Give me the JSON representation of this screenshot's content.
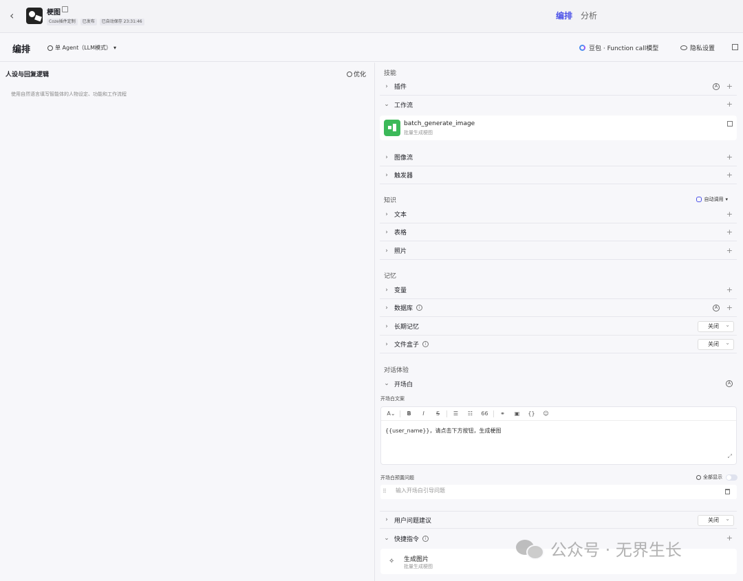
{
  "header": {
    "bot_name": "梗图",
    "tags": [
      "Coze插件定制",
      "已发布",
      "已自动保存 23:31:46"
    ],
    "tabs": [
      {
        "label": "编排",
        "active": true
      },
      {
        "label": "分析",
        "active": false
      }
    ]
  },
  "subheader": {
    "title": "编排",
    "mode": "单 Agent（LLM模式）",
    "model": "豆包 · Function call模型",
    "privacy": "隐私设置"
  },
  "left": {
    "title": "人设与回复逻辑",
    "optimize": "优化",
    "placeholder": "使用自然语言填写智能体的人物设定、功能和工作流程"
  },
  "skills": {
    "label": "技能",
    "plugins": "插件",
    "workflow": "工作流",
    "workflow_item": {
      "name": "batch_generate_image",
      "desc": "批量生成梗图"
    },
    "imageflow": "图像流",
    "trigger": "触发器"
  },
  "knowledge": {
    "label": "知识",
    "auto_call": "自动调用",
    "text": "文本",
    "table": "表格",
    "photo": "照片"
  },
  "memory": {
    "label": "记忆",
    "variables": "变量",
    "database": "数据库",
    "long_term": "长期记忆",
    "long_term_value": "关闭",
    "filebox": "文件盒子",
    "filebox_value": "关闭"
  },
  "dialog": {
    "label": "对话体验",
    "opening": "开场白",
    "opening_text_label": "开场白文案",
    "opening_text": "{{user_name}}，请点击下方按钮，生成梗图",
    "preset_label": "开场白预置问题",
    "show_all": "全部显示",
    "preset_placeholder": "输入开场白引导问题",
    "suggestions": "用户问题建议",
    "suggestions_value": "关闭",
    "shortcuts": "快捷指令",
    "shortcut_item": {
      "name": "生成图片",
      "desc": "批量生成梗图"
    }
  },
  "watermark": "公众号 · 无界生长",
  "colors": {
    "accent": "#4d53e8",
    "workflow_icon": "#3cb959"
  }
}
